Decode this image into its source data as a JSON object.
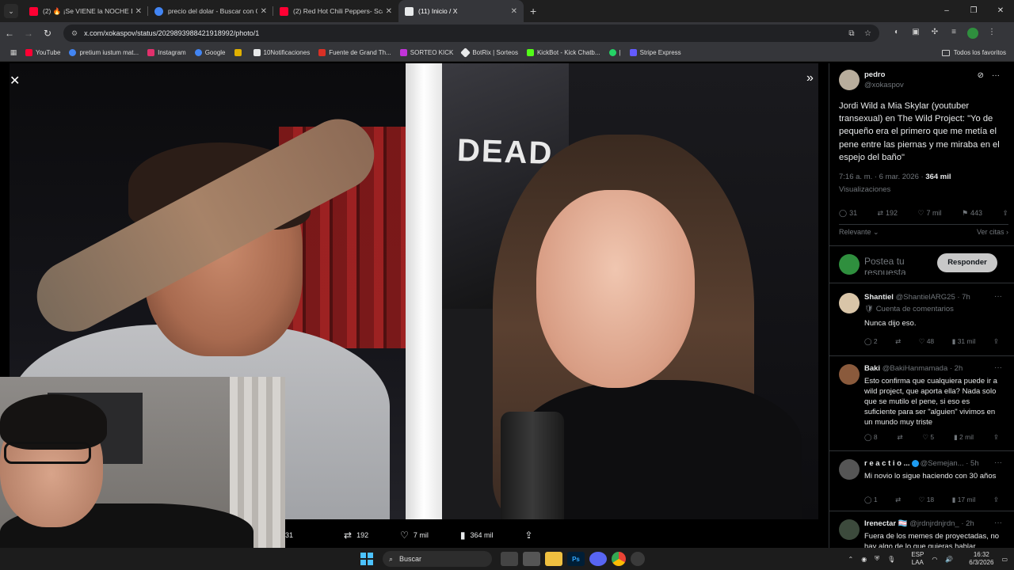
{
  "browser": {
    "tabs": [
      {
        "title": "(2) 🔥 ¡Se VIENE la NOCHE DO",
        "color": "#ff0033",
        "active": false
      },
      {
        "title": "precio del dolar - Buscar con G",
        "color": "#4285f4",
        "active": false
      },
      {
        "title": "(2) Red Hot Chili Peppers- Scar",
        "color": "#ff0033",
        "active": false
      },
      {
        "title": "(11) Inicio / X",
        "color": "#e7e9ea",
        "active": true
      }
    ],
    "new_tab": "+",
    "window_controls": [
      "–",
      "❐",
      "✕"
    ],
    "url": "x.com/xokaspov/status/2029893988421918992/photo/1",
    "bookmarks": [
      {
        "label": "YouTube",
        "color": "#ff0033"
      },
      {
        "label": "pretium iustum mat...",
        "color": "#4285f4"
      },
      {
        "label": "Instagram",
        "color": "#e1306c"
      },
      {
        "label": "Google",
        "color": "#4285f4"
      },
      {
        "label": "",
        "color": "#e0b000"
      },
      {
        "label": "10Notificaciones",
        "color": "#e7e9ea"
      },
      {
        "label": "Fuente de Grand Th...",
        "color": "#d93025"
      },
      {
        "label": "SORTEO KICK",
        "color": "#c133d9"
      },
      {
        "label": "BotRix | Sorteos",
        "color": "#e7e9ea"
      },
      {
        "label": "KickBot - Kick Chatb...",
        "color": "#53fc18"
      },
      {
        "label": "",
        "color": "#25d366"
      },
      {
        "label": "|",
        "color": "#35363a"
      },
      {
        "label": "Stripe Express",
        "color": "#635bff"
      }
    ],
    "all_bookmarks": "Todos los favoritos"
  },
  "viewer": {
    "poster_text": "DEAD",
    "actions": {
      "replies": "31",
      "reposts": "192",
      "likes": "7 mil",
      "views": "364 mil"
    }
  },
  "tweet": {
    "name": "pedro",
    "handle": "@xokaspov",
    "text": "Jordi Wild a Mia Skylar (youtuber transexual) en The Wild Project: \"Yo de pequeño era el primero que me metía el pene entre las piernas y me miraba en el espejo del baño\"",
    "time": "7:16 a. m. · 6 mar. 2026 · ",
    "views": "364 mil",
    "views_label": "Visualizaciones",
    "stats": {
      "replies": "31",
      "reposts": "192",
      "likes": "7 mil",
      "bookmarks": "443"
    },
    "sort": "Relevante",
    "see_quotes": "Ver citas",
    "reply_placeholder": "Postea tu respuesta",
    "reply_button": "Responder",
    "accent": "#1d9bf0"
  },
  "replies": [
    {
      "name": "Shantiel",
      "handle": "@ShantielARG25 · 7h",
      "sub": "🛡 Cuenta de comentarios",
      "text": "Nunca dijo eso.",
      "replies": "2",
      "reposts": "",
      "likes": "48",
      "views": "31 mil",
      "avatar": "#d9c5a8"
    },
    {
      "name": "Baki",
      "handle": "@BakiHanmamada · 2h",
      "sub": "",
      "text": "Esto confirma que cualquiera puede ir a wild project, que aporta ella? Nada solo que se mutilo el pene, si eso es suficiente para ser \"alguien\" vivimos en un mundo muy triste",
      "replies": "8",
      "reposts": "",
      "likes": "5",
      "views": "2 mil",
      "avatar": "#8a5a3c"
    },
    {
      "name": "r e a c t i o ...",
      "handle": "@Semejan... · 5h",
      "sub": "",
      "text": "Mi novio lo sigue haciendo con 30 años",
      "replies": "1",
      "reposts": "",
      "likes": "18",
      "views": "17 mil",
      "avatar": "#555"
    },
    {
      "name": "Irenectar 🏳️‍⚧️",
      "handle": "@jrdnjrdnjrdn_ · 2h",
      "sub": "",
      "text": "Fuera de los memes de proyectadas, no hay algo de lo que quieras hablar",
      "replies": "",
      "reposts": "",
      "likes": "",
      "views": "",
      "avatar": "#3c4a3c"
    }
  ],
  "taskbar": {
    "search_placeholder": "Buscar",
    "lang_top": "ESP",
    "lang_bottom": "LAA",
    "time": "16:32",
    "date": "6/3/2026",
    "apps": [
      {
        "label": "",
        "color": "#444"
      },
      {
        "label": "",
        "color": "#555"
      },
      {
        "label": "",
        "color": "#f0c040"
      },
      {
        "label": "Ps",
        "color": "#001e36"
      },
      {
        "label": "",
        "color": "#5865f2"
      },
      {
        "label": "",
        "color": "#3a3a3a"
      },
      {
        "label": "",
        "color": "#3a3a3a"
      }
    ]
  }
}
